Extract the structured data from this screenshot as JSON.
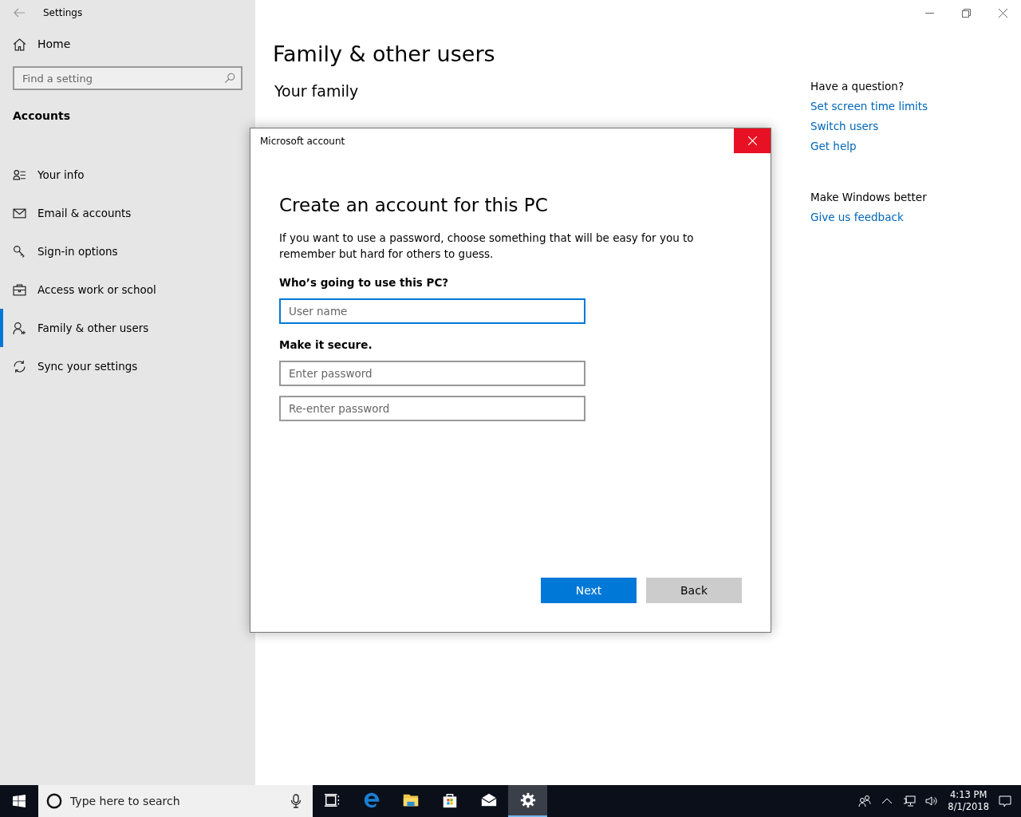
{
  "window": {
    "title": "Settings"
  },
  "sidebar": {
    "home": "Home",
    "search": {
      "placeholder": "Find a setting"
    },
    "section": "Accounts",
    "items": [
      {
        "label": "Your info",
        "kind": "info",
        "selected": false
      },
      {
        "label": "Email & accounts",
        "kind": "mail",
        "selected": false
      },
      {
        "label": "Sign-in options",
        "kind": "key",
        "selected": false
      },
      {
        "label": "Access work or school",
        "kind": "briefcase",
        "selected": false
      },
      {
        "label": "Family & other users",
        "kind": "family",
        "selected": true
      },
      {
        "label": "Sync your settings",
        "kind": "sync",
        "selected": false
      }
    ]
  },
  "main": {
    "title": "Family & other users",
    "subtitle": "Your family"
  },
  "aside": [
    {
      "title": "Have a question?",
      "links": [
        "Set screen time limits",
        "Switch users",
        "Get help"
      ]
    },
    {
      "title": "Make Windows better",
      "links": [
        "Give us feedback"
      ]
    }
  ],
  "dialog": {
    "title": "Microsoft account",
    "heading": "Create an account for this PC",
    "description": "If you want to use a password, choose something that will be easy for you to remember but hard for others to guess.",
    "groups": [
      {
        "label": "Who’s going to use this PC?",
        "fields": [
          {
            "placeholder": "User name",
            "focused": true
          }
        ]
      },
      {
        "label": "Make it secure.",
        "fields": [
          {
            "placeholder": "Enter password",
            "focused": false
          },
          {
            "placeholder": "Re-enter password",
            "focused": false
          }
        ]
      }
    ],
    "buttons": [
      {
        "label": "Next",
        "kind": "primary"
      },
      {
        "label": "Back",
        "kind": "secondary"
      }
    ]
  },
  "taskbar": {
    "search": {
      "placeholder": "Type here to search"
    },
    "apps": [
      {
        "kind": "taskview",
        "selected": false
      },
      {
        "kind": "edge",
        "selected": false
      },
      {
        "kind": "explorer",
        "selected": false
      },
      {
        "kind": "store",
        "selected": false
      },
      {
        "kind": "mail",
        "selected": false
      },
      {
        "kind": "settings",
        "selected": true
      }
    ],
    "time": "4:13 PM",
    "date": "8/1/2018"
  }
}
